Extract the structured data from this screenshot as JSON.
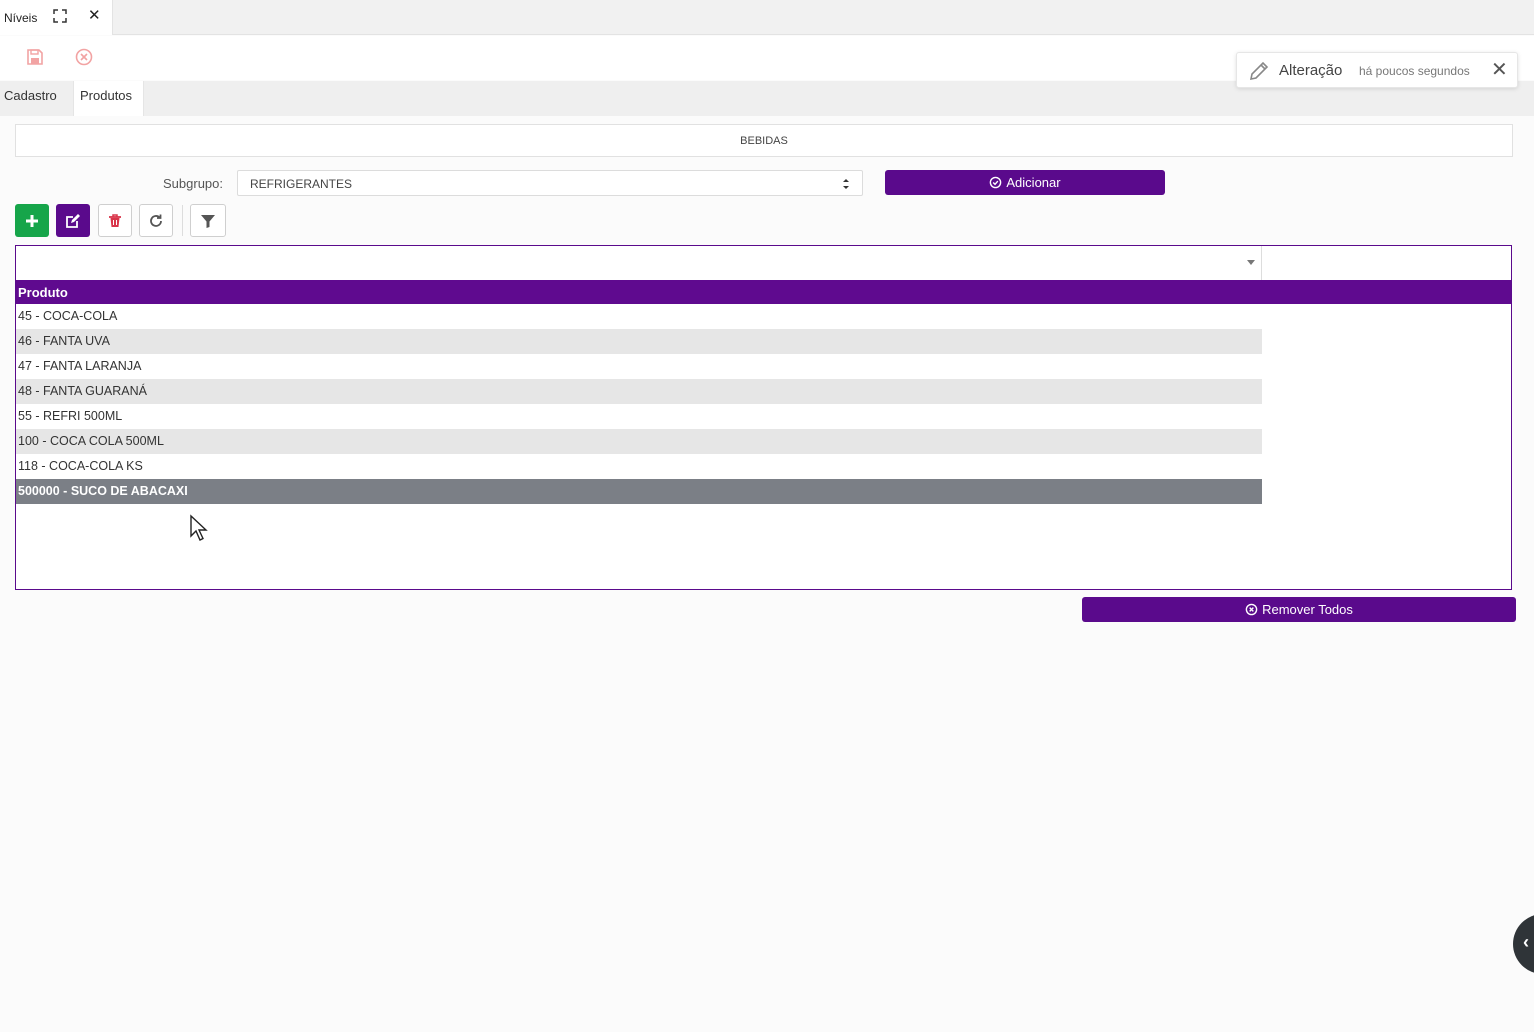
{
  "window_tab": {
    "title": "Níveis"
  },
  "section_tabs": [
    {
      "label": "Cadastro"
    },
    {
      "label": "Produtos"
    }
  ],
  "notification": {
    "label": "Alteração",
    "time": "há poucos segundos"
  },
  "group": {
    "name": "BEBIDAS"
  },
  "subgrupo": {
    "label": "Subgrupo:",
    "value": "REFRIGERANTES"
  },
  "buttons": {
    "adicionar": "Adicionar",
    "remover_todos": "Remover Todos"
  },
  "grid": {
    "column": "Produto",
    "rows": [
      "45 - COCA-COLA",
      "46 - FANTA UVA",
      "47 - FANTA LARANJA",
      "48 - FANTA GUARANÁ",
      "55 - REFRI 500ML",
      "100 - COCA COLA 500ML",
      "118 - COCA-COLA KS",
      "500000 - SUCO DE ABACAXI"
    ],
    "selected_index": 7
  },
  "colors": {
    "accent": "#5a0a8c",
    "add": "#16a54a",
    "delete": "#d9354a"
  }
}
